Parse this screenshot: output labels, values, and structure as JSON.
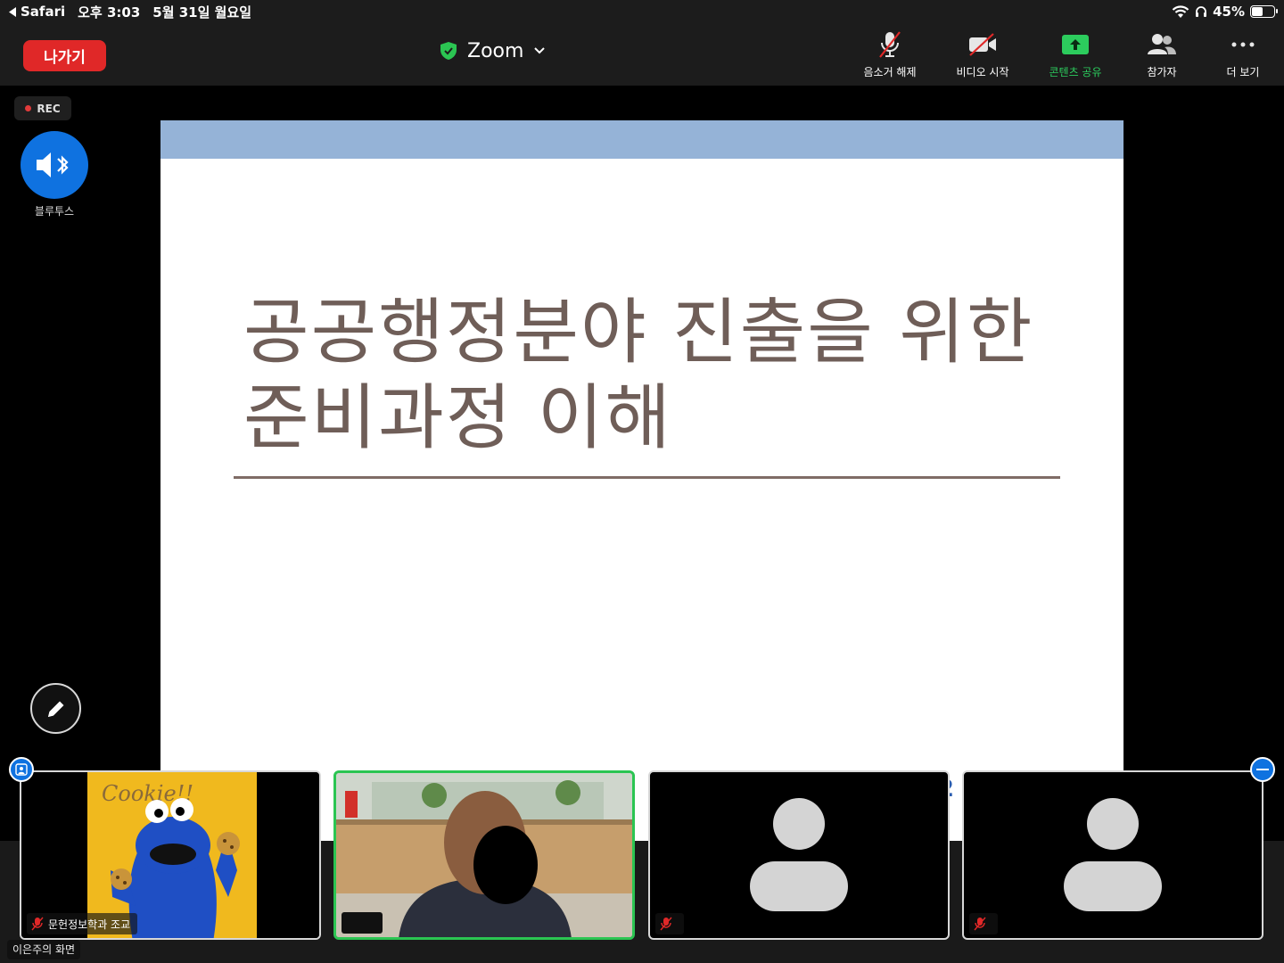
{
  "status_bar": {
    "back_app": "Safari",
    "time": "오후 3:03",
    "date": "5월 31일 월요일",
    "battery": "45%",
    "battery_level": 0.45
  },
  "top_bar": {
    "leave_label": "나가기",
    "meeting_title": "Zoom",
    "toolbar": [
      {
        "label": "음소거 해제",
        "icon": "microphone-muted-icon"
      },
      {
        "label": "비디오 시작",
        "icon": "video-off-icon"
      },
      {
        "label": "콘텐츠 공유",
        "icon": "share-content-icon",
        "color": "#2ccc5d"
      },
      {
        "label": "참가자",
        "icon": "participants-icon"
      },
      {
        "label": "더 보기",
        "icon": "more-icon"
      }
    ]
  },
  "rec_label": "REC",
  "audio": {
    "label": "블루투스",
    "icon": "bluetooth-speaker-icon"
  },
  "slide": {
    "title_line1": "공공행정분야 진출을 위한",
    "title_line2": "준비과정 이해",
    "page_number": "2",
    "band_color": "#95b3d7",
    "title_color": "#6f5e58"
  },
  "participants": [
    {
      "name": "문헌정보학과 조교",
      "muted": true,
      "video": "cookie-image",
      "cookie_text": "Cookie!!"
    },
    {
      "name": "",
      "muted": false,
      "video": "camera-feed",
      "active_speaker": true
    },
    {
      "name": "",
      "muted": true,
      "video": "avatar-placeholder"
    },
    {
      "name": "",
      "muted": true,
      "video": "avatar-placeholder"
    }
  ],
  "screen_owner": "이은주의 화면",
  "colors": {
    "accent_blue": "#0f72e0",
    "leave_red": "#e02828",
    "active_green": "#2bc552"
  }
}
